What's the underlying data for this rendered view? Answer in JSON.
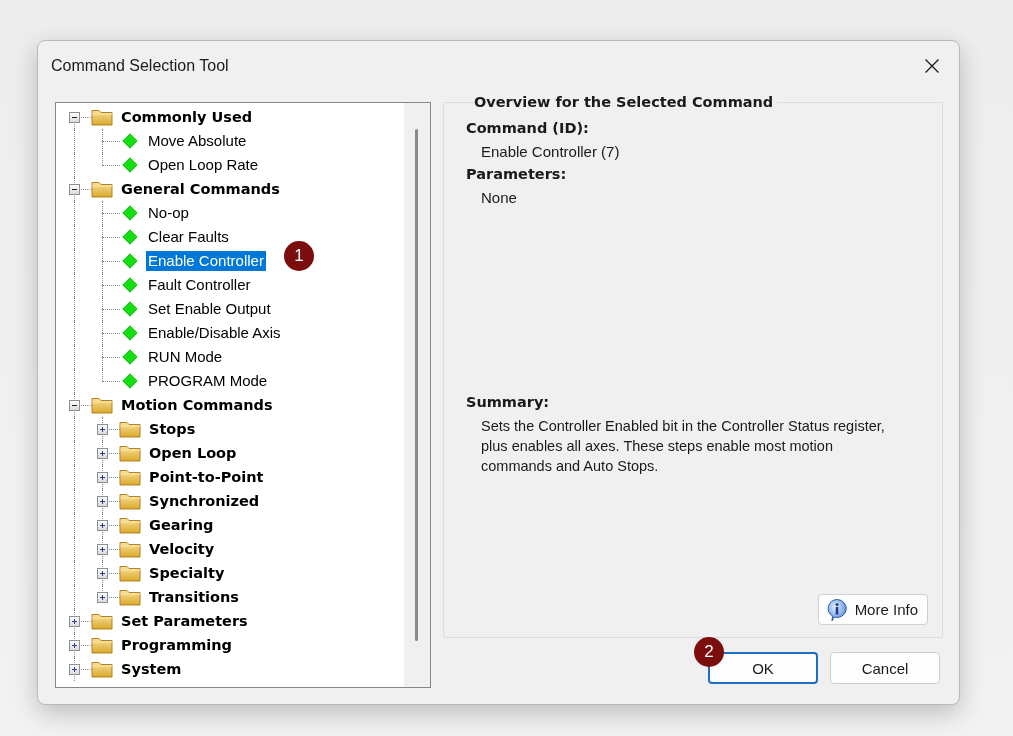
{
  "window": {
    "title": "Command Selection Tool"
  },
  "tree": [
    {
      "kind": "folder",
      "label": "Commonly Used",
      "expanded": true,
      "selected": false,
      "children": [
        {
          "kind": "command",
          "label": "Move Absolute",
          "selected": false
        },
        {
          "kind": "command",
          "label": "Open Loop Rate",
          "selected": false
        }
      ]
    },
    {
      "kind": "folder",
      "label": "General Commands",
      "expanded": true,
      "selected": false,
      "children": [
        {
          "kind": "command",
          "label": "No-op",
          "selected": false
        },
        {
          "kind": "command",
          "label": "Clear Faults",
          "selected": false
        },
        {
          "kind": "command",
          "label": "Enable Controller",
          "selected": true
        },
        {
          "kind": "command",
          "label": "Fault Controller",
          "selected": false
        },
        {
          "kind": "command",
          "label": "Set Enable Output",
          "selected": false
        },
        {
          "kind": "command",
          "label": "Enable/Disable Axis",
          "selected": false
        },
        {
          "kind": "command",
          "label": "RUN Mode",
          "selected": false
        },
        {
          "kind": "command",
          "label": "PROGRAM Mode",
          "selected": false
        }
      ]
    },
    {
      "kind": "folder",
      "label": "Motion Commands",
      "expanded": true,
      "selected": false,
      "children": [
        {
          "kind": "folder",
          "label": "Stops",
          "expanded": false,
          "selected": false
        },
        {
          "kind": "folder",
          "label": "Open Loop",
          "expanded": false,
          "selected": false
        },
        {
          "kind": "folder",
          "label": "Point-to-Point",
          "expanded": false,
          "selected": false
        },
        {
          "kind": "folder",
          "label": "Synchronized",
          "expanded": false,
          "selected": false
        },
        {
          "kind": "folder",
          "label": "Gearing",
          "expanded": false,
          "selected": false
        },
        {
          "kind": "folder",
          "label": "Velocity",
          "expanded": false,
          "selected": false
        },
        {
          "kind": "folder",
          "label": "Specialty",
          "expanded": false,
          "selected": false
        },
        {
          "kind": "folder",
          "label": "Transitions",
          "expanded": false,
          "selected": false
        }
      ]
    },
    {
      "kind": "folder",
      "label": "Set Parameters",
      "expanded": false,
      "selected": false
    },
    {
      "kind": "folder",
      "label": "Programming",
      "expanded": false,
      "selected": false
    },
    {
      "kind": "folder",
      "label": "System",
      "expanded": false,
      "selected": false
    }
  ],
  "overview": {
    "title": "Overview for the Selected Command",
    "sections": [
      {
        "heading": "Command (ID):",
        "text": "Enable Controller (7)"
      },
      {
        "heading": "Parameters:",
        "text": "None"
      }
    ],
    "summary": {
      "heading": "Summary:",
      "text": "Sets the Controller Enabled bit in the Controller Status register, plus enables all axes. These steps enable most motion commands and Auto Stops."
    },
    "more_info_button": "More Info"
  },
  "buttons": [
    {
      "label": "OK",
      "default": true
    },
    {
      "label": "Cancel",
      "default": false
    }
  ],
  "annotations": [
    {
      "label": "1"
    },
    {
      "label": "2"
    }
  ]
}
